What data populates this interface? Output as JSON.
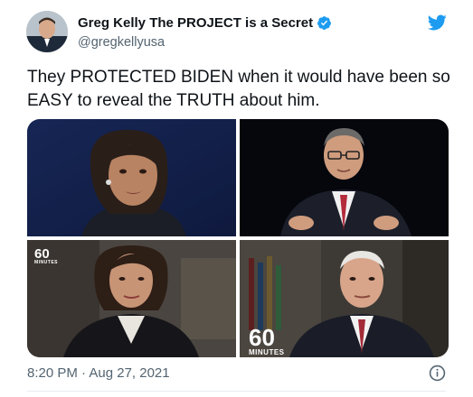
{
  "tweet": {
    "display_name": "Greg Kelly The PROJECT is a Secret",
    "handle": "@gregkellyusa",
    "verified_icon": "verified-badge-icon",
    "text": "They PROTECTED BIDEN when it would have been so EASY to reveal the TRUTH about him.",
    "timestamp": "8:20 PM · Aug 27, 2021",
    "media": [
      {
        "description": "woman-debate-moderator",
        "logo": ""
      },
      {
        "description": "man-debate-moderator",
        "logo": ""
      },
      {
        "description": "woman-60-minutes-correspondent",
        "logo": "60",
        "logo_sub": "MINUTES"
      },
      {
        "description": "joe-biden-60-minutes",
        "logo": "60",
        "logo_sub": "MINUTES"
      }
    ]
  },
  "colors": {
    "brand_blue": "#1d9bf0",
    "text_primary": "#0f1419",
    "text_secondary": "#536471"
  },
  "icons": {
    "twitter": "twitter-bird-icon",
    "info": "info-icon"
  }
}
